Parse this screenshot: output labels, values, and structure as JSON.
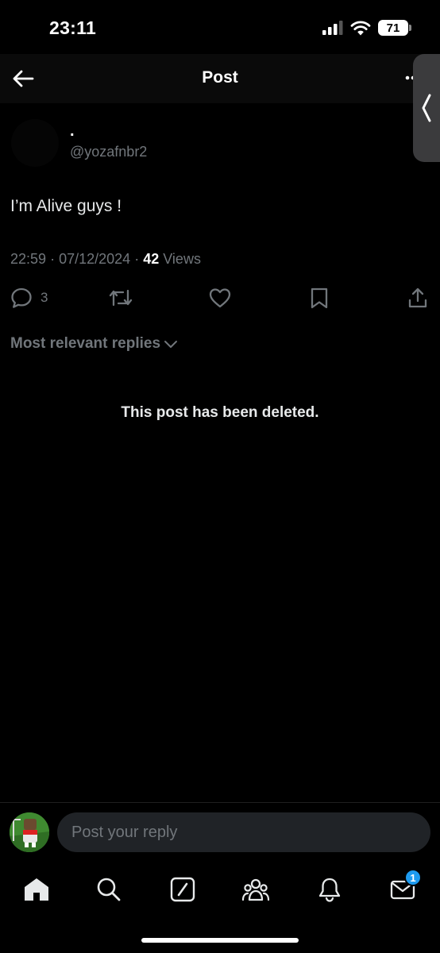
{
  "status_bar": {
    "time": "23:11",
    "battery_level": "71",
    "icons": [
      "signal-icon",
      "wifi-icon"
    ]
  },
  "header": {
    "title": "Post",
    "back_icon": "arrow-left-icon",
    "more_icon": "more-icon"
  },
  "post": {
    "display_name": ".",
    "handle": "@yozafnbr2",
    "text": "I’m Alive guys !",
    "time": "22:59",
    "separator": "·",
    "date": "07/12/2024",
    "views_count": "42",
    "views_label": "Views",
    "reply_count": "3"
  },
  "replies": {
    "sort_label": "Most relevant replies",
    "deleted_message": "This post has been deleted."
  },
  "reply_bar": {
    "placeholder": "Post your reply"
  },
  "tab_bar": {
    "notification_badge": "1"
  },
  "colors": {
    "background": "#000000",
    "muted": "#71767b",
    "accent": "#1d9bf0"
  }
}
